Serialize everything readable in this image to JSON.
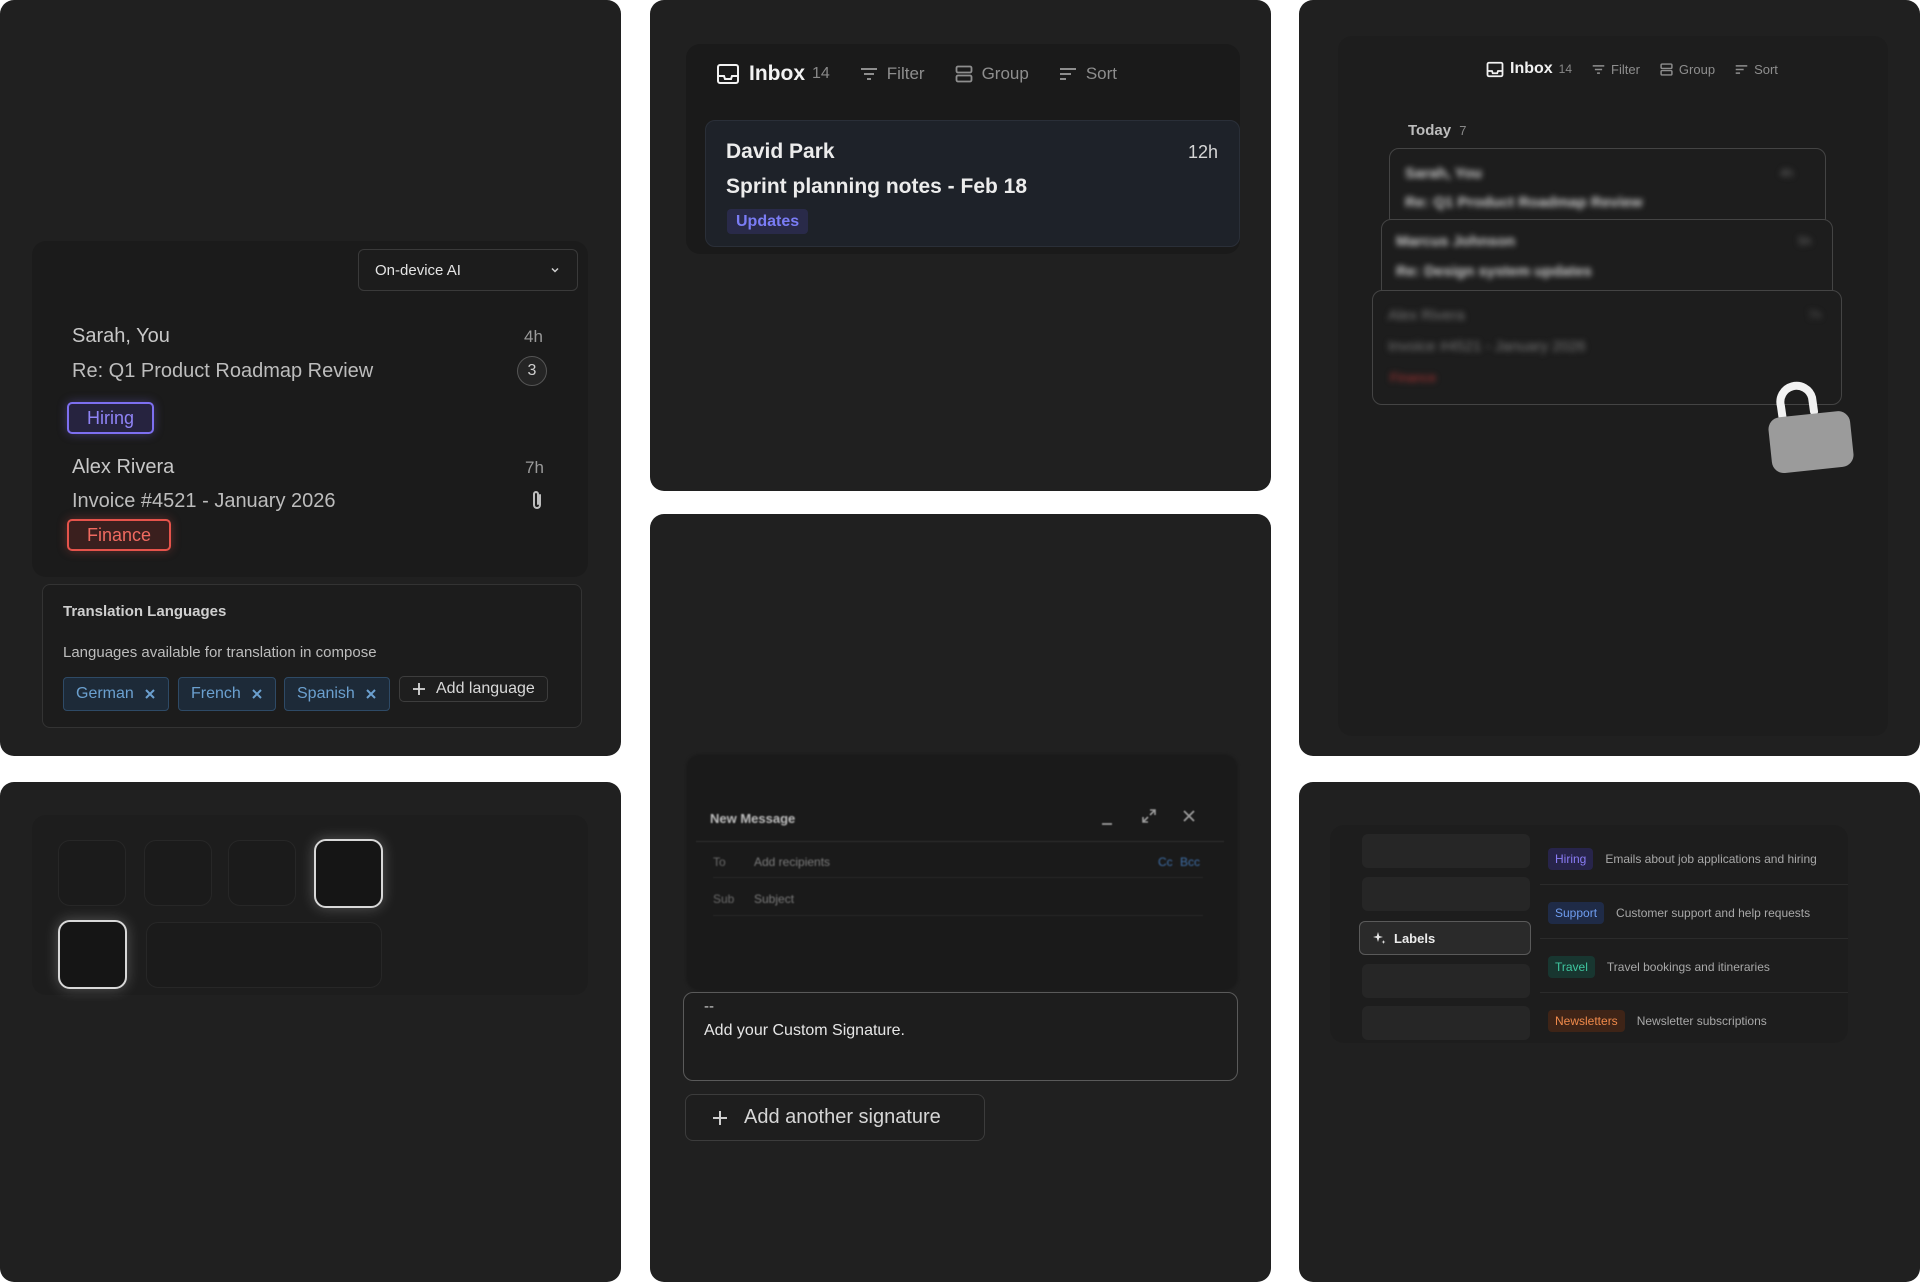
{
  "tile1": {
    "ghost_title": "",
    "ai_select": {
      "value": "On-device AI"
    },
    "threads": [
      {
        "name": "Sarah, You",
        "subject": "Re: Q1 Product Roadmap Review",
        "time": "4h",
        "count": "3",
        "tag": "Hiring",
        "tag_color": "#7d6ff0"
      },
      {
        "name": "Alex Rivera",
        "subject": "Invoice #4521 - January 2026",
        "time": "7h",
        "tag": "Finance",
        "tag_color": "#e5534b"
      }
    ],
    "translation": {
      "title": "Translation Languages",
      "description": "Languages available for translation in compose",
      "languages": [
        "German",
        "French",
        "Spanish"
      ],
      "add_label": "Add language"
    }
  },
  "tile2": {
    "toolbar": {
      "inbox": "Inbox",
      "count": "14",
      "filter": "Filter",
      "group": "Group",
      "sort": "Sort"
    },
    "card": {
      "sender": "David Park",
      "subject": "Sprint planning notes - Feb 18",
      "time": "12h",
      "tag": "Updates"
    }
  },
  "tile3": {
    "toolbar": {
      "inbox": "Inbox",
      "count": "14",
      "filter": "Filter",
      "group": "Group",
      "sort": "Sort"
    },
    "section": {
      "label": "Today",
      "count": "7"
    },
    "cards": [
      {
        "sender": "Sarah, You",
        "subject": "Re: Q1 Product Roadmap Review",
        "time": "4h"
      },
      {
        "sender": "Marcus Johnson",
        "subject": "Re: Design system updates",
        "time": "5h"
      },
      {
        "sender": "Alex Rivera",
        "subject": "Invoice #4521 - January 2026",
        "time": "7h",
        "tag": "Finance"
      }
    ]
  },
  "compose": {
    "title": "New Message",
    "to_label": "To",
    "to_placeholder": "Add recipients",
    "cc": "Cc",
    "bcc": "Bcc",
    "sub_label": "Sub",
    "subject_placeholder": "Subject",
    "signature_dashes": "--",
    "signature_text": "Add your Custom Signature.",
    "add_signature": "Add another signature"
  },
  "labels_tile": {
    "nav_active": "Labels",
    "labels": [
      {
        "name": "Hiring",
        "description": "Emails about job applications and hiring",
        "color": "#8a7cf5",
        "bg": "#27244a"
      },
      {
        "name": "Support",
        "description": "Customer support and help requests",
        "color": "#6f9df0",
        "bg": "#1f2b47"
      },
      {
        "name": "Travel",
        "description": "Travel bookings and itineraries",
        "color": "#3fc7a0",
        "bg": "#183630"
      },
      {
        "name": "Newsletters",
        "description": "Newsletter subscriptions",
        "color": "#f08a4b",
        "bg": "#3e2417"
      }
    ]
  }
}
